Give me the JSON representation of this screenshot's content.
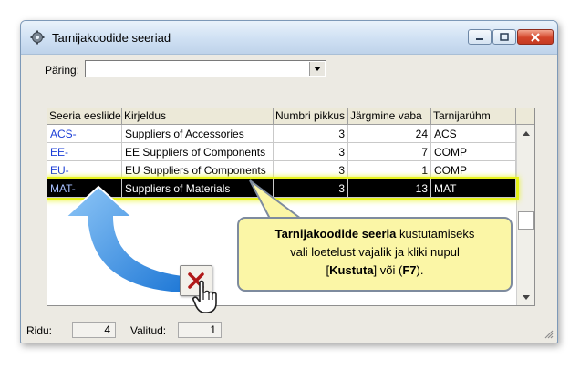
{
  "window": {
    "title": "Tarnijakoodide seeriad",
    "icon": "gear-icon"
  },
  "query": {
    "label": "Päring:",
    "value": ""
  },
  "grid": {
    "columns": [
      "Seeria eesliide",
      "Kirjeldus",
      "Numbri pikkus",
      "Järgmine vaba",
      "Tarnijarühm"
    ],
    "rows": [
      [
        "ACS-",
        "Suppliers of Accessories",
        "3",
        "24",
        "ACS"
      ],
      [
        "EE-",
        "EE Suppliers of Components",
        "3",
        "7",
        "COMP"
      ],
      [
        "EU-",
        "EU Suppliers of Components",
        "3",
        "1",
        "COMP"
      ],
      [
        "MAT-",
        "Suppliers of Materials",
        "3",
        "13",
        "MAT"
      ]
    ],
    "selected_row": 3
  },
  "status": {
    "rows_label": "Ridu:",
    "rows_value": "4",
    "selected_label": "Valitud:",
    "selected_value": "1"
  },
  "callout": {
    "bold1": "Tarnijakoodide  seeria",
    "text1": " kustutamiseks",
    "line2": "vali loetelust vajalik ja kliki nupul",
    "open_bracket": "[",
    "bold2": "Kustuta",
    "text3": "] või (",
    "bold3": "F7",
    "text4": ")."
  },
  "colors": {
    "accent_blue": "#1d3fd6",
    "highlight": "#e6f21a",
    "callout_bg": "#fbf6a6",
    "arrow_blue": "#2a86e0"
  }
}
